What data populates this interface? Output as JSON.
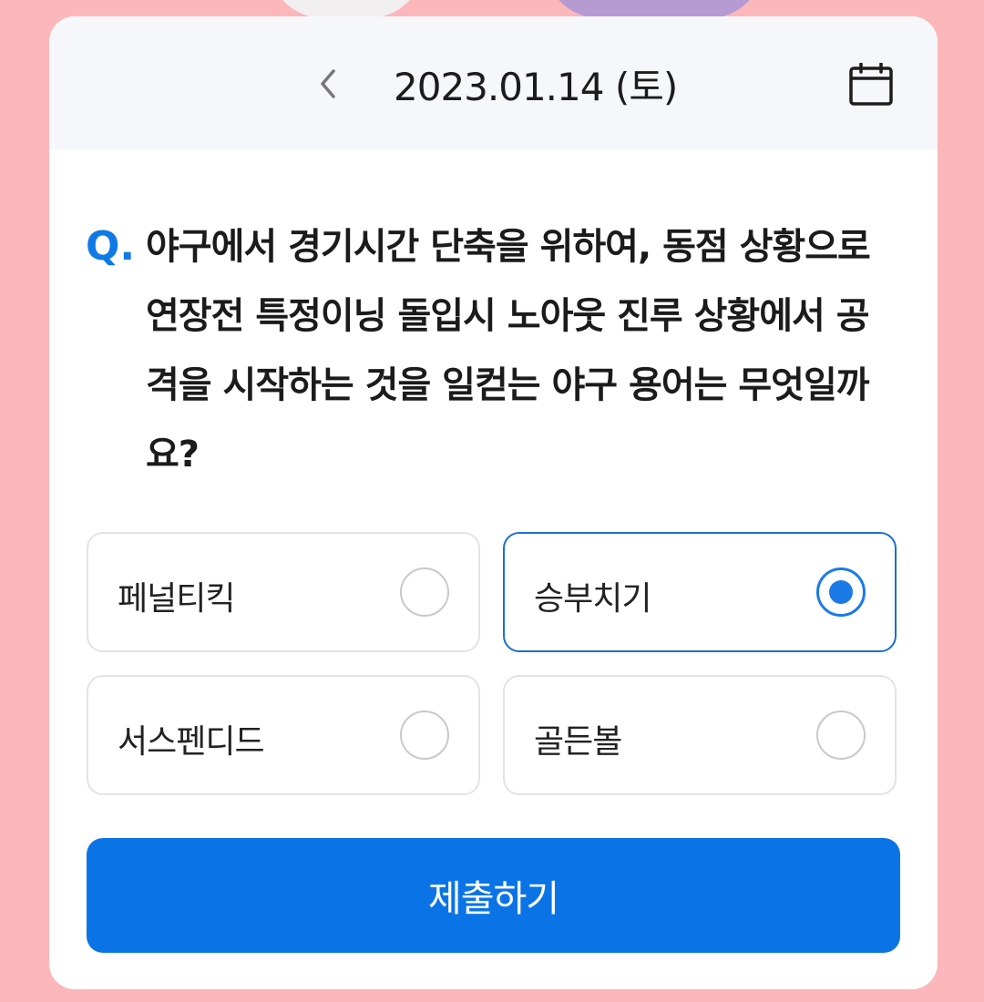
{
  "header": {
    "date": "2023.01.14 (토)",
    "prev_icon": "chevron-left-icon",
    "calendar_icon": "calendar-icon"
  },
  "question": {
    "prefix": "Q.",
    "text": "야구에서 경기시간 단축을 위하여, 동점 상황으로 연장전 특정이닝 돌입시 노아웃 진루 상황에서 공격을 시작하는 것을 일컫는 야구 용어는 무엇일까요?"
  },
  "options": [
    {
      "label": "페널티킥",
      "selected": false
    },
    {
      "label": "승부치기",
      "selected": true
    },
    {
      "label": "서스펜디드",
      "selected": false
    },
    {
      "label": "골든볼",
      "selected": false
    }
  ],
  "submit": {
    "label": "제출하기"
  },
  "colors": {
    "background": "#fbb7b9",
    "accent": "#0a74e6"
  }
}
